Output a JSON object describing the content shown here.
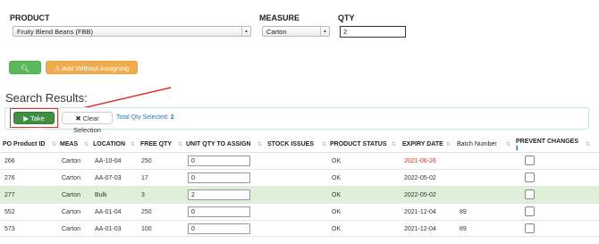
{
  "filters": {
    "product_label": "PRODUCT",
    "product_value": "Fruity Blend Beans (FBB)",
    "measure_label": "MEASURE",
    "measure_value": "Carton",
    "qty_label": "QTY",
    "qty_value": "2"
  },
  "actions": {
    "search_label": "Search",
    "assign_label": "Add Without Assigning Stock"
  },
  "results": {
    "heading": "Search Results:",
    "take_stock_label": "Take Stock",
    "clear_selection_label": "Clear Selection",
    "total_qty_text": "Total Qty Selected:",
    "total_qty_value": "2"
  },
  "table": {
    "headers": {
      "po_product_id": "PO Product ID",
      "meas": "MEAS",
      "location": "LOCATION",
      "free_qty": "FREE QTY",
      "unit_qty": "UNIT QTY TO ASSIGN",
      "stock_issues": "STOCK ISSUES",
      "product_status": "PRODUCT STATUS",
      "expiry_date": "EXPIRY DATE",
      "batch_number": "Batch Number",
      "prevent_changes": "PREVENT CHANGES"
    },
    "rows": [
      {
        "id": "266",
        "meas": "Carton",
        "location": "AA-10-04",
        "free_qty": "250",
        "assign": "0",
        "status": "OK",
        "expiry": "2021-06-26",
        "batch": "",
        "expired": true,
        "highlighted": false
      },
      {
        "id": "276",
        "meas": "Carton",
        "location": "AA-07-03",
        "free_qty": "17",
        "assign": "0",
        "status": "OK",
        "expiry": "2022-05-02",
        "batch": "",
        "expired": false,
        "highlighted": false
      },
      {
        "id": "277",
        "meas": "Carton",
        "location": "Bulk",
        "free_qty": "3",
        "assign": "2",
        "status": "OK",
        "expiry": "2022-05-02",
        "batch": "",
        "expired": false,
        "highlighted": true
      },
      {
        "id": "552",
        "meas": "Carton",
        "location": "AA-01-04",
        "free_qty": "250",
        "assign": "0",
        "status": "OK",
        "expiry": "2021-12-04",
        "batch": "89",
        "expired": false,
        "highlighted": false
      },
      {
        "id": "573",
        "meas": "Carton",
        "location": "AA-01-03",
        "free_qty": "100",
        "assign": "0",
        "status": "OK",
        "expiry": "2021-12-04",
        "batch": "89",
        "expired": false,
        "highlighted": false
      }
    ]
  },
  "icons": {
    "search": "magnifier-icon",
    "warning": "warning-icon",
    "play": "play-icon",
    "close": "close-icon",
    "info": "info-icon",
    "sort": "sort-icon"
  },
  "colors": {
    "green": "#5cb85c",
    "orange": "#f0ad4e",
    "highlight_red": "#e0332c",
    "row_highlight": "#dff0d8",
    "link_blue": "#2a7ab0"
  }
}
